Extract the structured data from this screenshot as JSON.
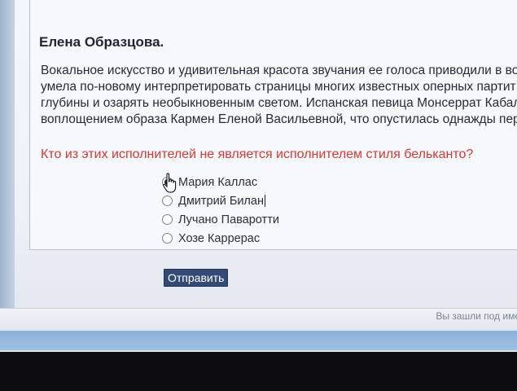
{
  "author": "Елена Образцова.",
  "paragraph_lines": [
    "Вокальное искусство и удивительная красота звучания ее голоса приводили в во",
    "умела по-новому интерпретировать страницы многих известных оперных партит",
    "глубины и озарять необыкновенным светом. Испанская певица Монсеррат Кабал",
    "воплощением образа Кармен Еленой Васильевной, что опустилась однажды пер"
  ],
  "question": "Кто из этих исполнителей не является исполнителем стиля бельканто?",
  "options": [
    {
      "label": "Мария Каллас",
      "selected": true
    },
    {
      "label": "Дмитрий Билан",
      "selected": false
    },
    {
      "label": "Лучано Паваротти",
      "selected": false
    },
    {
      "label": "Хозе Каррерас",
      "selected": false
    }
  ],
  "submit_label": "Отправить",
  "footer_note": "Вы зашли под име"
}
